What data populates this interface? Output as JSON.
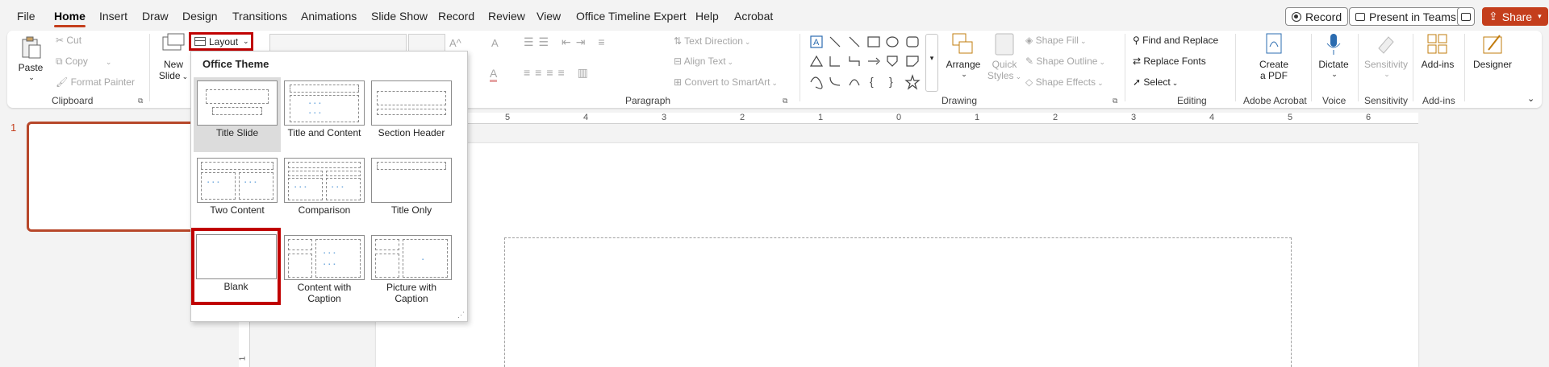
{
  "menu": {
    "tabs": [
      "File",
      "Home",
      "Insert",
      "Draw",
      "Design",
      "Transitions",
      "Animations",
      "Slide Show",
      "Record",
      "Review",
      "View",
      "Office Timeline Expert",
      "Help",
      "Acrobat"
    ],
    "active": "Home",
    "record_btn": "Record",
    "present_btn": "Present in Teams",
    "share_btn": "Share"
  },
  "ribbon": {
    "clipboard": {
      "paste": "Paste",
      "cut": "Cut",
      "copy": "Copy",
      "format_painter": "Format Painter",
      "label": "Clipboard"
    },
    "slides": {
      "new_slide_l1": "New",
      "new_slide_l2": "Slide",
      "layout": "Layout"
    },
    "paragraph": {
      "text_direction": "Text Direction",
      "align_text": "Align Text",
      "convert_smartart": "Convert to SmartArt",
      "label": "Paragraph"
    },
    "drawing": {
      "arrange": "Arrange",
      "quick_styles_l1": "Quick",
      "quick_styles_l2": "Styles",
      "shape_fill": "Shape Fill",
      "shape_outline": "Shape Outline",
      "shape_effects": "Shape Effects",
      "label": "Drawing"
    },
    "editing": {
      "find_replace": "Find and Replace",
      "replace_fonts": "Replace Fonts",
      "select": "Select",
      "label": "Editing"
    },
    "acrobat": {
      "create_l1": "Create",
      "create_l2": "a PDF",
      "label": "Adobe Acrobat"
    },
    "voice": {
      "dictate": "Dictate",
      "label": "Voice"
    },
    "sensitivity": {
      "btn": "Sensitivity",
      "label": "Sensitivity"
    },
    "addins": {
      "btn": "Add-ins",
      "label": "Add-ins"
    },
    "designer": {
      "btn": "Designer"
    }
  },
  "slide_panel": {
    "number": "1"
  },
  "ruler": {
    "h_ticks": [
      "5",
      "4",
      "3",
      "2",
      "1",
      "0",
      "1",
      "2",
      "3",
      "4",
      "5",
      "6"
    ],
    "v_tick": "1"
  },
  "layout_gallery": {
    "title": "Office Theme",
    "selected": "Title Slide",
    "highlighted": "Blank",
    "items": [
      {
        "name": "Title Slide"
      },
      {
        "name": "Title and Content"
      },
      {
        "name": "Section Header"
      },
      {
        "name": "Two Content"
      },
      {
        "name": "Comparison"
      },
      {
        "name": "Title Only"
      },
      {
        "name": "Blank"
      },
      {
        "name": "Content with Caption"
      },
      {
        "name": "Picture with Caption"
      }
    ]
  },
  "colors": {
    "accent": "#c43e1c",
    "highlight": "#c00000",
    "share_bg": "#c43e1c"
  }
}
